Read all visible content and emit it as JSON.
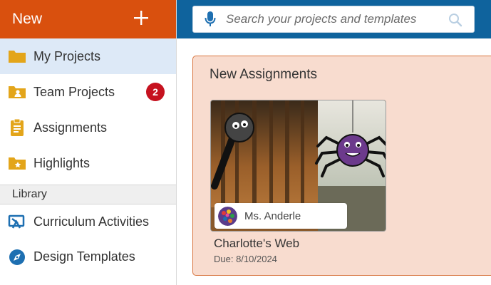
{
  "sidebar": {
    "new_label": "New",
    "items": [
      {
        "label": "My Projects",
        "icon": "folder-icon"
      },
      {
        "label": "Team Projects",
        "icon": "team-folder-icon",
        "badge": "2"
      },
      {
        "label": "Assignments",
        "icon": "clipboard-icon"
      },
      {
        "label": "Highlights",
        "icon": "star-folder-icon"
      }
    ],
    "library_header": "Library",
    "library_items": [
      {
        "label": "Curriculum Activities",
        "icon": "curriculum-icon"
      },
      {
        "label": "Design Templates",
        "icon": "compass-icon"
      }
    ]
  },
  "search": {
    "placeholder": "Search your projects and templates"
  },
  "main": {
    "section_title": "New Assignments",
    "assignment": {
      "teacher": "Ms. Anderle",
      "title": "Charlotte's Web",
      "due": "Due: 8/10/2024"
    }
  },
  "colors": {
    "new_button": "#d9500e",
    "topbar": "#0f639d",
    "active_item": "#dde9f7",
    "badge": "#c6121f",
    "panel_bg": "#f8dccf",
    "panel_border": "#d8753f",
    "icon_yellow": "#e3a51a",
    "icon_blue": "#1d6fb1"
  }
}
